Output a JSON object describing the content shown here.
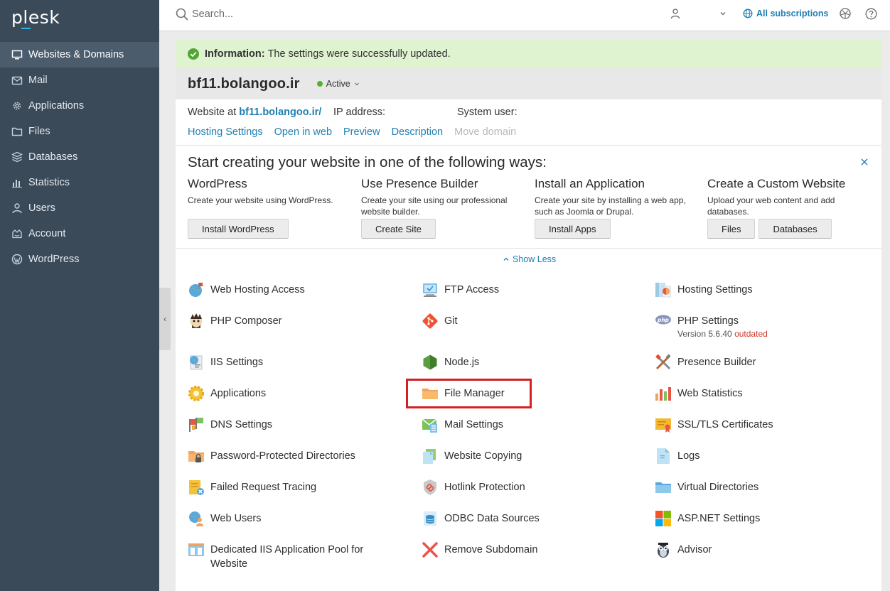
{
  "brand": {
    "logo": "plesk"
  },
  "sidebar": {
    "items": [
      {
        "label": "Websites & Domains",
        "icon": "monitor-icon",
        "active": true
      },
      {
        "label": "Mail",
        "icon": "mail-icon"
      },
      {
        "label": "Applications",
        "icon": "gear-icon"
      },
      {
        "label": "Files",
        "icon": "folder-icon"
      },
      {
        "label": "Databases",
        "icon": "database-icon"
      },
      {
        "label": "Statistics",
        "icon": "bar-chart-icon"
      },
      {
        "label": "Users",
        "icon": "user-icon"
      },
      {
        "label": "Account",
        "icon": "account-icon"
      },
      {
        "label": "WordPress",
        "icon": "wordpress-icon"
      }
    ],
    "collapse_glyph": "‹"
  },
  "topbar": {
    "search_placeholder": "Search...",
    "subscriptions_label": "All subscriptions"
  },
  "info": {
    "prefix": "Information:",
    "message": "The settings were successfully updated."
  },
  "domain": {
    "name": "bf11.bolangoo.ir",
    "status": "Active",
    "website_at_label": "Website at",
    "url": "bf11.bolangoo.ir/",
    "ip_label": "IP address:",
    "system_user_label": "System user:",
    "links": [
      "Hosting Settings",
      "Open in web",
      "Preview",
      "Description"
    ],
    "disabled_link": "Move domain"
  },
  "start": {
    "title": "Start creating your website in one of the following ways:",
    "columns": [
      {
        "heading": "WordPress",
        "desc": "Create your website using WordPress.",
        "buttons": [
          "Install WordPress"
        ]
      },
      {
        "heading": "Use Presence Builder",
        "desc": "Create your site using our professional website builder.",
        "buttons": [
          "Create Site"
        ]
      },
      {
        "heading": "Install an Application",
        "desc": "Create your site by installing a web app, such as Joomla or Drupal.",
        "buttons": [
          "Install Apps"
        ]
      },
      {
        "heading": "Create a Custom Website",
        "desc": "Upload your web content and add databases.",
        "buttons": [
          "Files",
          "Databases"
        ]
      }
    ],
    "show_less": "Show Less"
  },
  "tools": {
    "col1": [
      {
        "label": "Web Hosting Access",
        "icon": "web-hosting-access-icon"
      },
      {
        "label": "PHP Composer",
        "icon": "php-composer-icon"
      },
      {
        "label": "IIS Settings",
        "icon": "iis-settings-icon"
      },
      {
        "label": "Applications",
        "icon": "applications-icon"
      },
      {
        "label": "DNS Settings",
        "icon": "dns-settings-icon"
      },
      {
        "label": "Password-Protected Directories",
        "icon": "password-directories-icon"
      },
      {
        "label": "Failed Request Tracing",
        "icon": "failed-request-tracing-icon"
      },
      {
        "label": "Web Users",
        "icon": "web-users-icon"
      },
      {
        "label": "Dedicated IIS Application Pool for Website",
        "icon": "iis-app-pool-icon"
      }
    ],
    "col2": [
      {
        "label": "FTP Access",
        "icon": "ftp-access-icon"
      },
      {
        "label": "Git",
        "icon": "git-icon"
      },
      {
        "label": "Node.js",
        "icon": "nodejs-icon"
      },
      {
        "label": "File Manager",
        "icon": "file-manager-icon"
      },
      {
        "label": "Mail Settings",
        "icon": "mail-settings-icon"
      },
      {
        "label": "Website Copying",
        "icon": "website-copying-icon"
      },
      {
        "label": "Hotlink Protection",
        "icon": "hotlink-protection-icon"
      },
      {
        "label": "ODBC Data Sources",
        "icon": "odbc-icon"
      },
      {
        "label": "Remove Subdomain",
        "icon": "remove-subdomain-icon"
      }
    ],
    "col3": [
      {
        "label": "Hosting Settings",
        "icon": "hosting-settings-icon"
      },
      {
        "label": "PHP Settings",
        "icon": "php-settings-icon",
        "sub": "Version 5.6.40",
        "sub_flag": "outdated"
      },
      {
        "label": "Presence Builder",
        "icon": "presence-builder-icon"
      },
      {
        "label": "Web Statistics",
        "icon": "web-statistics-icon"
      },
      {
        "label": "SSL/TLS Certificates",
        "icon": "ssl-certificates-icon"
      },
      {
        "label": "Logs",
        "icon": "logs-icon"
      },
      {
        "label": "Virtual Directories",
        "icon": "virtual-directories-icon"
      },
      {
        "label": "ASP.NET Settings",
        "icon": "aspnet-icon"
      },
      {
        "label": "Advisor",
        "icon": "advisor-icon"
      }
    ]
  },
  "colors": {
    "sidebar": "#3a4a59",
    "accent": "#1e7fb3",
    "success_bg": "#dff3d0",
    "highlight": "#d42020"
  }
}
